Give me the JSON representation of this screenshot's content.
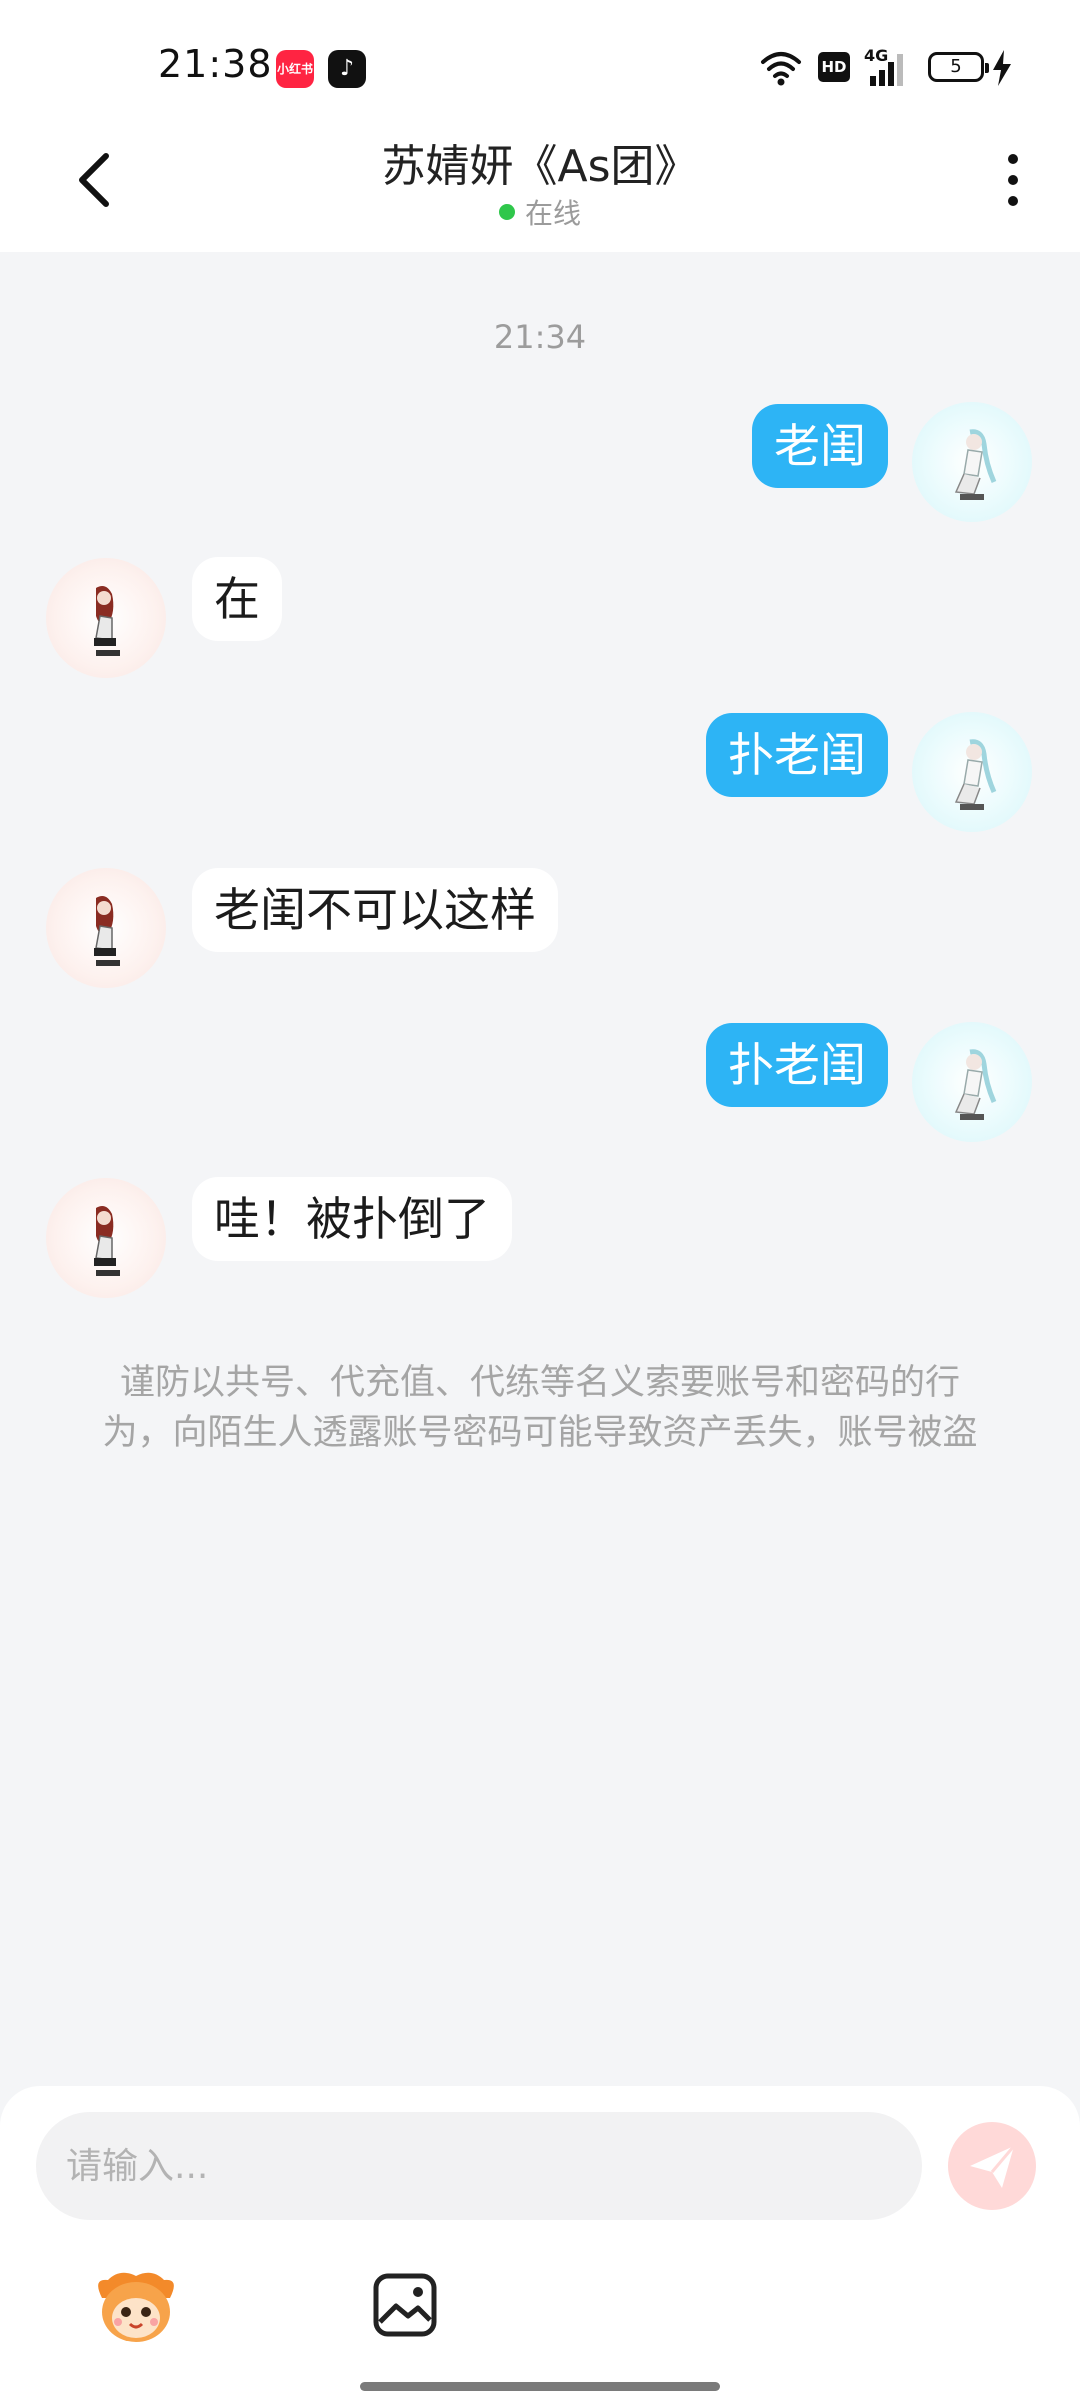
{
  "status_bar": {
    "time": "21:38",
    "app_badge_xhs": "小红书",
    "network": "4G",
    "hd": "HD",
    "battery": "5"
  },
  "header": {
    "title": "苏婧妍《As团》",
    "presence": "在线",
    "presence_color": "#2fc74b"
  },
  "chat": {
    "timestamp": "21:34",
    "messages": [
      {
        "side": "mine",
        "text": "老闺"
      },
      {
        "side": "peer",
        "text": "在"
      },
      {
        "side": "mine",
        "text": "扑老闺"
      },
      {
        "side": "peer",
        "text": "老闺不可以这样"
      },
      {
        "side": "mine",
        "text": "扑老闺"
      },
      {
        "side": "peer",
        "text": "哇！被扑倒了"
      }
    ],
    "notice_line1": "谨防以共号、代充值、代练等名义索要账号和密码的行",
    "notice_line2": "为，向陌生人透露账号密码可能导致资产丢失，账号被盗"
  },
  "input": {
    "placeholder": "请输入..."
  },
  "colors": {
    "bubble_mine": "#2db4f5",
    "bubble_peer": "#ffffff",
    "send_button": "#ffd9d8",
    "background": "#f4f5f7"
  },
  "icons": {
    "back": "chevron-left-icon",
    "more": "more-vertical-icon",
    "send": "send-icon",
    "mascot": "mascot-emoji-icon",
    "image": "image-icon"
  }
}
